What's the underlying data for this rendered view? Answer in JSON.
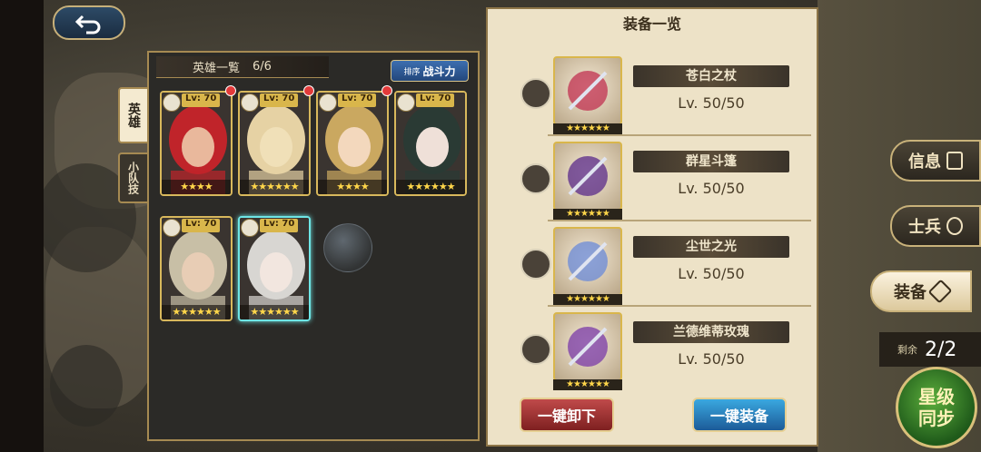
{
  "nav": {
    "back_icon": "back-arrow-icon"
  },
  "side_tabs": [
    {
      "label": "英雄",
      "active": true
    },
    {
      "label": "小队技",
      "active": false
    }
  ],
  "hero_panel": {
    "title": "英雄一覧",
    "count": "6/6",
    "sort_small": "排序",
    "sort_big": "战斗力"
  },
  "heroes": [
    {
      "level": "Lv: 70",
      "stars": "★★★★",
      "badge": true,
      "class_icon": "sword-class-icon",
      "hair": "#c0242a",
      "skin": "#e9b89c"
    },
    {
      "level": "Lv: 70",
      "stars": "★★★★★★",
      "badge": true,
      "class_icon": "wolf-class-icon",
      "hair": "#e6d2a4",
      "skin": "#f0e0b8"
    },
    {
      "level": "Lv: 70",
      "stars": "★★★★",
      "badge": true,
      "class_icon": "staff-class-icon",
      "hair": "#caa860",
      "skin": "#f3d8bd"
    },
    {
      "level": "Lv: 70",
      "stars": "★★★★★★",
      "badge": false,
      "class_icon": "mask-class-icon",
      "hair": "#2a3a34",
      "skin": "#efe0d8"
    },
    {
      "level": "Lv: 70",
      "stars": "★★★★★★",
      "badge": false,
      "class_icon": "staff-class-icon",
      "hair": "#c8bfa6",
      "skin": "#e8cdb5"
    },
    {
      "level": "Lv: 70",
      "stars": "★★★★★★",
      "badge": false,
      "class_icon": "staff-class-icon",
      "hair": "#d8d6d2",
      "skin": "#f2e6df"
    }
  ],
  "equip_panel": {
    "title": "装备一览",
    "items": [
      {
        "name": "苍白之杖",
        "level": "Lv. 50/50",
        "stars": "★★★★★★",
        "slot_icon": "sword-slot-icon",
        "art": "staff-item",
        "color": "#c03050"
      },
      {
        "name": "群星斗篷",
        "level": "Lv. 50/50",
        "stars": "★★★★★★",
        "slot_icon": "armor-slot-icon",
        "art": "cloak-item",
        "color": "#5a2a8a"
      },
      {
        "name": "尘世之光",
        "level": "Lv. 50/50",
        "stars": "★★★★★★",
        "slot_icon": "helm-slot-icon",
        "art": "crown-item",
        "color": "#6a8ad8"
      },
      {
        "name": "兰德维蒂玫瑰",
        "level": "Lv. 50/50",
        "stars": "★★★★★★",
        "slot_icon": "ring-slot-icon",
        "art": "rose-item",
        "color": "#7a3aa8"
      }
    ],
    "unequip_label": "一键卸下",
    "equip_label": "一键装备"
  },
  "right_menu": {
    "info": "信息",
    "soldier": "士兵",
    "equip": "装备",
    "remain_label": "剩余",
    "remain_value": "2/2",
    "star_sync_line1": "星级",
    "star_sync_line2": "同步"
  }
}
